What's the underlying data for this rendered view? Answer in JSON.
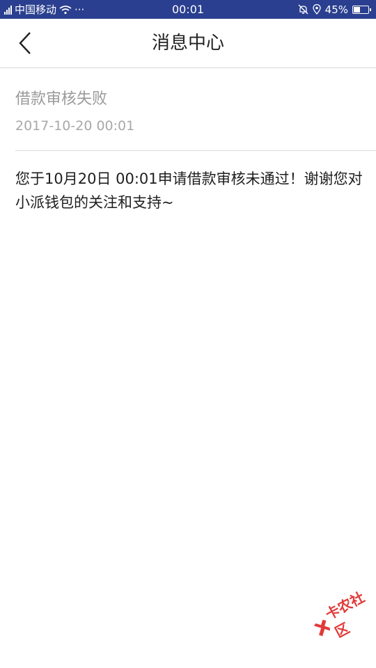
{
  "status_bar": {
    "carrier": "中国移动",
    "more_indicator": "···",
    "time": "00:01",
    "battery_percent": "45%",
    "battery_level": 0.45,
    "icons": [
      "signal-icon",
      "wifi-icon",
      "mute-bell-icon",
      "location-icon",
      "battery-icon"
    ]
  },
  "header": {
    "title": "消息中心",
    "back_icon": "chevron-left-icon"
  },
  "message": {
    "title": "借款审核失败",
    "time": "2017-10-20 00:01",
    "body": "您于10月20日 00:01申请借款审核未通过！谢谢您对小派钱包的关注和支持~"
  },
  "watermark": {
    "text": "卡农社区"
  },
  "colors": {
    "status_bar_bg": "#2a3f8f",
    "title_text": "#222222",
    "muted_text": "#9a9a9a",
    "body_text": "#1e1e1e",
    "watermark": "#e23a3a"
  }
}
